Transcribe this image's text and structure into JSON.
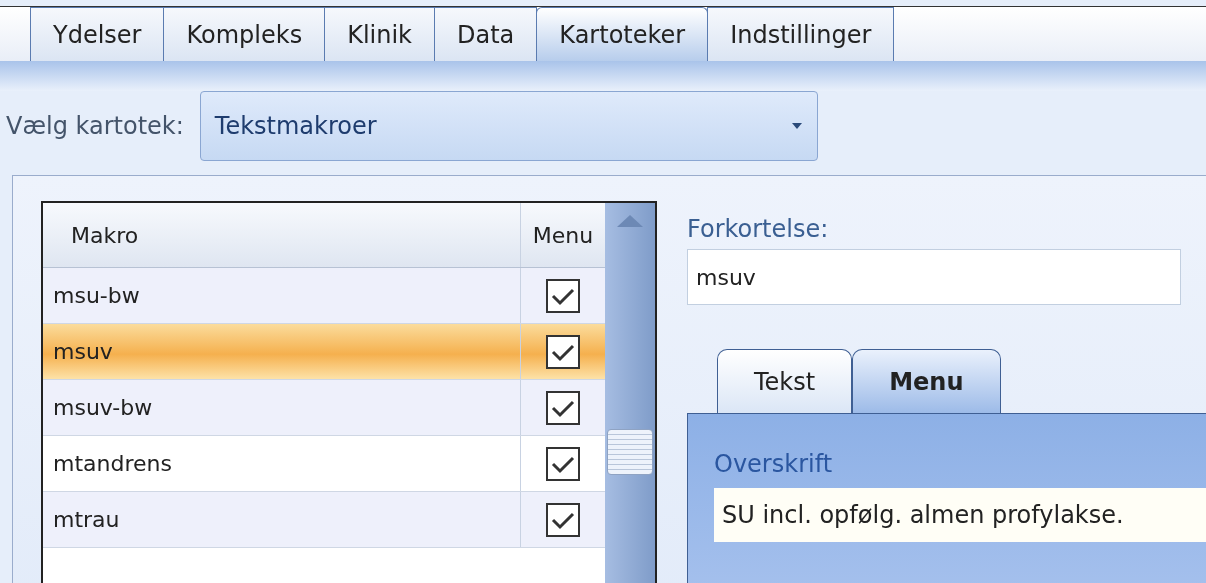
{
  "tabs": [
    {
      "label": "Ydelser",
      "selected": false
    },
    {
      "label": "Kompleks",
      "selected": false
    },
    {
      "label": "Klinik",
      "selected": false
    },
    {
      "label": "Data",
      "selected": false
    },
    {
      "label": "Kartoteker",
      "selected": true
    },
    {
      "label": "Indstillinger",
      "selected": false
    }
  ],
  "selector": {
    "label": "Vælg kartotek:",
    "value": "Tekstmakroer"
  },
  "table": {
    "columns": [
      "Makro",
      "Menu"
    ],
    "rows": [
      {
        "makro": "msu-bw",
        "menu": true,
        "selected": false
      },
      {
        "makro": "msuv",
        "menu": true,
        "selected": true
      },
      {
        "makro": "msuv-bw",
        "menu": true,
        "selected": false
      },
      {
        "makro": "mtandrens",
        "menu": true,
        "selected": false
      },
      {
        "makro": "mtrau",
        "menu": true,
        "selected": false
      }
    ]
  },
  "abbreviation": {
    "label": "Forkortelse:",
    "value": "msuv"
  },
  "detail_tabs": [
    {
      "label": "Tekst",
      "selected": false
    },
    {
      "label": "Menu",
      "selected": true
    }
  ],
  "heading": {
    "label": "Overskrift",
    "value": "SU incl. opfølg. almen profylakse."
  }
}
